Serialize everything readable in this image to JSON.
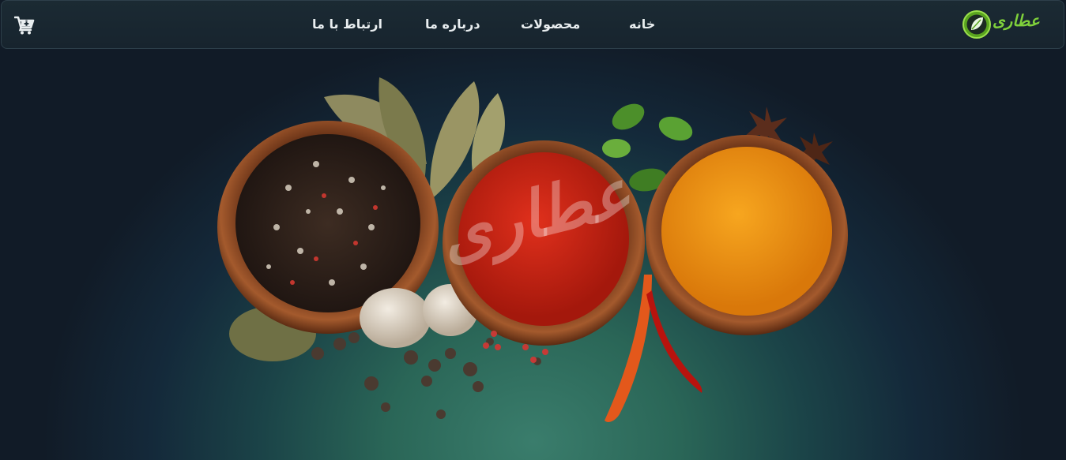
{
  "navbar": {
    "cart_icon": "cart-plus-icon",
    "links": {
      "home": "خانه",
      "products": "محصولات",
      "about": "درباره ما",
      "contact": "ارتباط با ما"
    },
    "logo_text": "عطاری",
    "logo_icon": "leaf-icon"
  },
  "hero": {
    "watermark": "عطاری",
    "image": "spice-bowls"
  },
  "colors": {
    "background_dark": "#111b27",
    "background_teal": "#3a7d6c",
    "navbar": "#1b2a33",
    "nav_text": "#e9eef0",
    "logo_green": "#7fd13b"
  }
}
